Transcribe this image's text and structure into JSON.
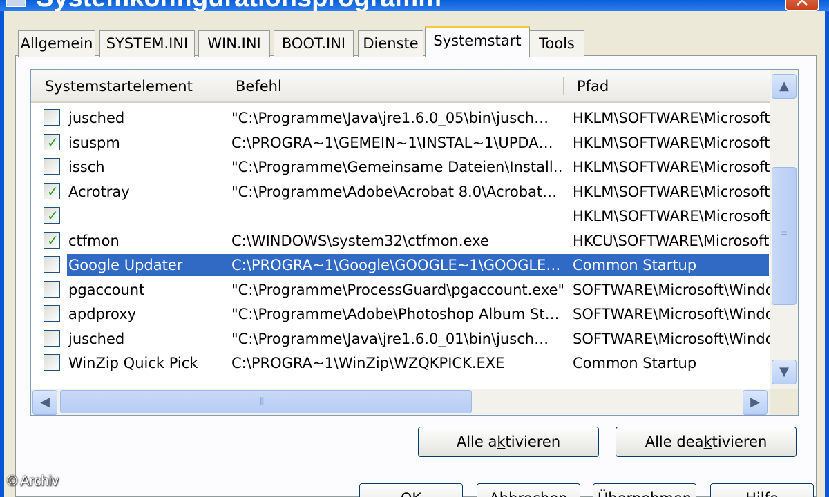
{
  "window": {
    "title": "Systemkonfigurationsprogramm",
    "close_label": "✕"
  },
  "tabs": [
    {
      "label": "Allgemein"
    },
    {
      "label": "SYSTEM.INI"
    },
    {
      "label": "WIN.INI"
    },
    {
      "label": "BOOT.INI"
    },
    {
      "label": "Dienste"
    },
    {
      "label": "Systemstart",
      "active": true
    },
    {
      "label": "Tools"
    }
  ],
  "list": {
    "columns": [
      "Systemstartelement",
      "Befehl",
      "Pfad"
    ],
    "rows": [
      {
        "checked": false,
        "name": "jusched",
        "command": "\"C:\\Programme\\Java\\jre1.6.0_05\\bin\\jusch…",
        "path": "HKLM\\SOFTWARE\\Microsoft"
      },
      {
        "checked": true,
        "name": "isuspm",
        "command": "C:\\PROGRA~1\\GEMEIN~1\\INSTAL~1\\UPDA…",
        "path": "HKLM\\SOFTWARE\\Microsoft"
      },
      {
        "checked": false,
        "name": "issch",
        "command": "\"C:\\Programme\\Gemeinsame Dateien\\Install…",
        "path": "HKLM\\SOFTWARE\\Microsoft"
      },
      {
        "checked": true,
        "name": "Acrotray",
        "command": "\"C:\\Programme\\Adobe\\Acrobat 8.0\\Acrobat…",
        "path": "HKLM\\SOFTWARE\\Microsoft"
      },
      {
        "checked": true,
        "name": "",
        "command": "",
        "path": "HKLM\\SOFTWARE\\Microsoft"
      },
      {
        "checked": true,
        "name": "ctfmon",
        "command": "C:\\WINDOWS\\system32\\ctfmon.exe",
        "path": "HKCU\\SOFTWARE\\Microsoft"
      },
      {
        "checked": false,
        "name": "Google Updater",
        "command": "C:\\PROGRA~1\\Google\\GOOGLE~1\\GOOGLE…",
        "path": "Common Startup",
        "selected": true
      },
      {
        "checked": false,
        "name": "pgaccount",
        "command": "\"C:\\Programme\\ProcessGuard\\pgaccount.exe\"",
        "path": "SOFTWARE\\Microsoft\\Windo"
      },
      {
        "checked": false,
        "name": "apdproxy",
        "command": "\"C:\\Programme\\Adobe\\Photoshop Album St…",
        "path": "SOFTWARE\\Microsoft\\Windo"
      },
      {
        "checked": false,
        "name": "jusched",
        "command": "\"C:\\Programme\\Java\\jre1.6.0_01\\bin\\jusch…",
        "path": "SOFTWARE\\Microsoft\\Windo"
      },
      {
        "checked": false,
        "name": "WinZip Quick Pick",
        "command": "C:\\PROGRA~1\\WinZip\\WZQKPICK.EXE",
        "path": "Common Startup"
      }
    ]
  },
  "scroll": {
    "up": "▲",
    "down": "▼",
    "left": "◀",
    "right": "▶",
    "vertical_position": 0.55,
    "horizontal_position": 0.0
  },
  "buttons": {
    "enable_all": {
      "pre": "Alle a",
      "key": "k",
      "post": "tivieren"
    },
    "disable_all": {
      "pre": "Alle dea",
      "key": "k",
      "post": "tivieren"
    },
    "ok": "OK",
    "cancel": "Abbrechen",
    "apply": "Übernehmen",
    "help": "Hilfe"
  },
  "watermark": "© Archiv",
  "colors": {
    "selection": "#316ac5",
    "check": "#21a121",
    "tab_accent": "#ffc83c"
  }
}
